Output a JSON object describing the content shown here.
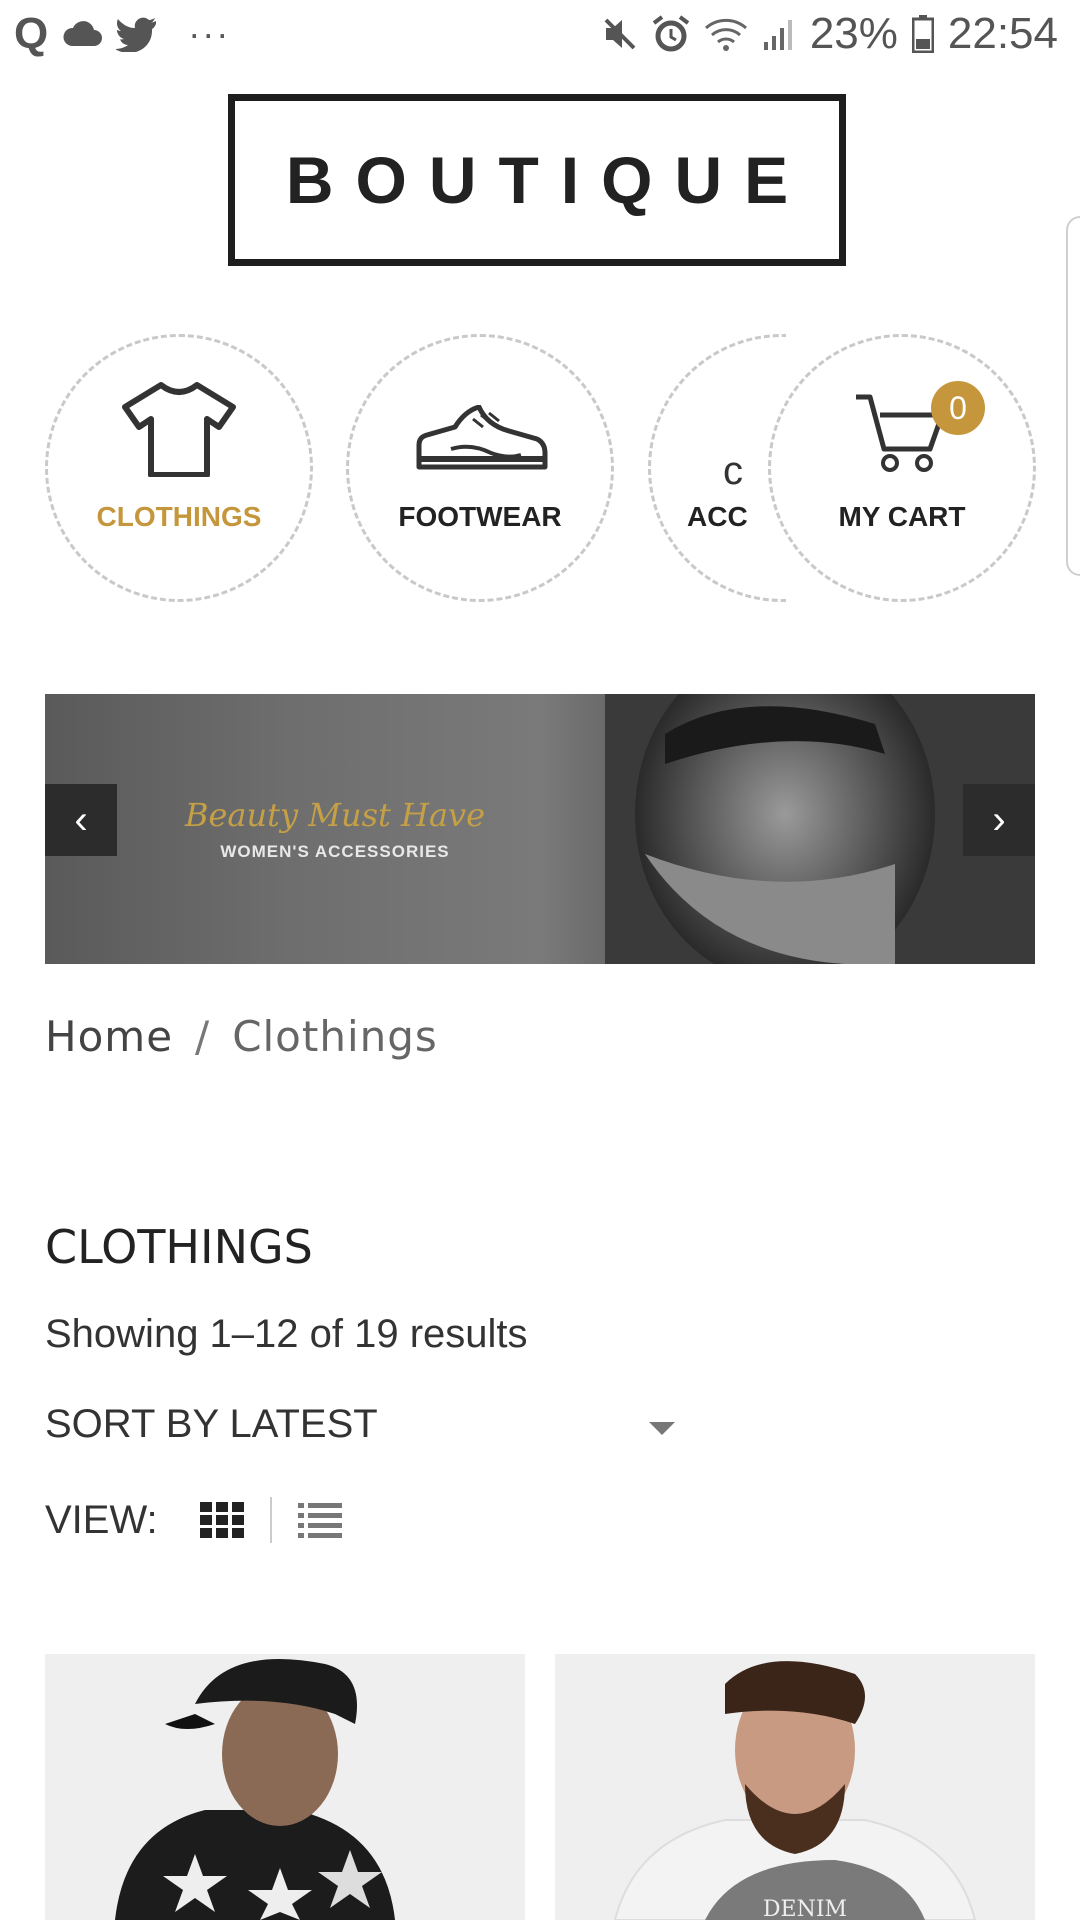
{
  "status_bar": {
    "battery": "23%",
    "time": "22:54"
  },
  "logo": {
    "text": "BOUTIQUE"
  },
  "categories": [
    {
      "label": "CLOTHINGS",
      "icon": "tshirt-icon",
      "active": true
    },
    {
      "label": "FOOTWEAR",
      "icon": "sneaker-icon",
      "active": false
    },
    {
      "label": "ACC",
      "icon": "accessories-icon",
      "active": false
    },
    {
      "label": "MY CART",
      "icon": "cart-icon",
      "active": false,
      "badge": "0"
    }
  ],
  "banner": {
    "script_text": "Beauty Must Have",
    "subtitle": "WOMEN'S ACCESSORIES",
    "prev": "‹",
    "next": "›"
  },
  "breadcrumb": {
    "home": "Home",
    "separator": "/",
    "current": "Clothings"
  },
  "listing": {
    "title": "CLOTHINGS",
    "results": "Showing 1–12 of 19 results",
    "sort_label": "SORT BY LATEST",
    "view_label": "VIEW:"
  },
  "colors": {
    "accent": "#c5963b",
    "text": "#222222",
    "banner_button": "#2c2c2c"
  }
}
